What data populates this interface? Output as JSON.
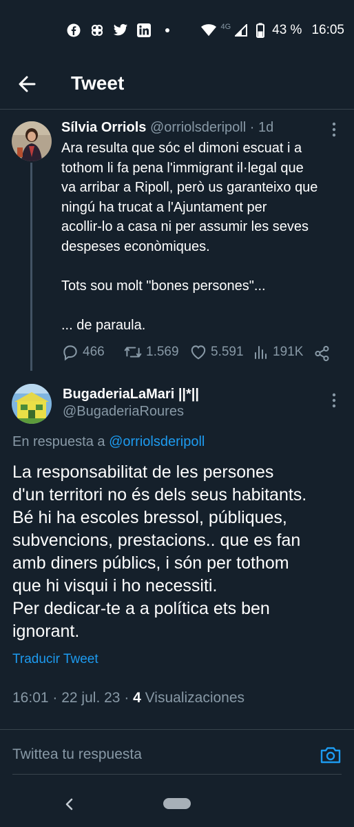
{
  "status_bar": {
    "icons_left": [
      "facebook-icon",
      "pinwheel-icon",
      "twitter-icon",
      "linkedin-icon",
      "dot-icon"
    ],
    "network": "4G",
    "battery": "43 %",
    "time": "16:05"
  },
  "app_bar": {
    "title": "Tweet"
  },
  "tweet_parent": {
    "name": "Sílvia Orriols",
    "handle": "@orriolsderipoll",
    "age": "· 1d",
    "text": "Ara resulta que sóc el dimoni escuat i a\ntothom li fa pena l'immigrant il·legal que\nva arribar a Ripoll, però us garanteixo que\nningú ha trucat a l'Ajuntament per\nacollir-lo a casa ni per assumir les seves\ndespeses econòmiques.\n\nTots sou molt \"bones persones\"...\n\n... de paraula.",
    "replies": "466",
    "retweets": "1.569",
    "likes": "5.591",
    "views": "191K"
  },
  "tweet_main": {
    "name": "BugaderiaLaMari ||*||",
    "handle": "@BugaderiaRoures",
    "reply_prefix": "En respuesta a",
    "reply_to": "@orriolsderipoll",
    "text": "La responsabilitat de les persones\nd'un territori no és dels seus habitants.\nBé hi ha escoles bressol, públiques,\nsubvencions, prestacions.. que es fan\namb diners públics, i són per tothom\nque hi visqui i ho necessiti.\nPer dedicar-te a a política ets ben\nignorant.",
    "translate_label": "Traducir Tweet",
    "time": "16:01",
    "date": "22 jul. 23",
    "views_count": "4",
    "views_label": "Visualizaciones"
  },
  "composer": {
    "placeholder": "Twittea tu respuesta"
  },
  "colors": {
    "background": "#15202b",
    "accent": "#1d9bf0",
    "secondary_text": "#8899a6",
    "divider": "#38444d"
  }
}
